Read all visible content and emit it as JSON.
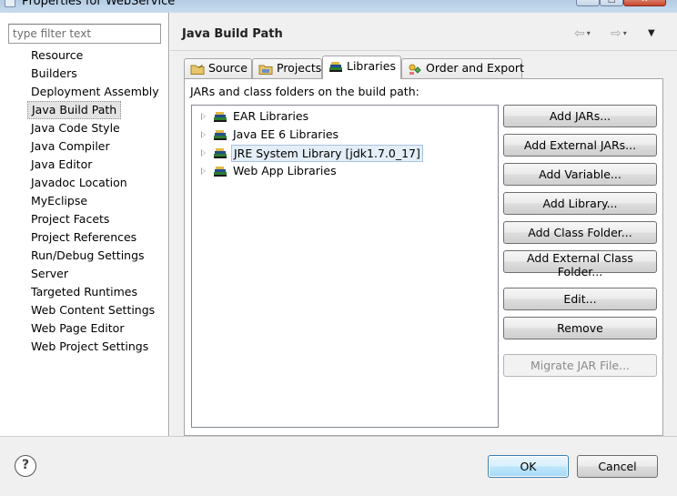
{
  "window": {
    "title": "Properties for WebService",
    "min_glyph": "─",
    "max_glyph": "□",
    "close_glyph": "✕"
  },
  "filter": {
    "placeholder": "type filter text",
    "value": ""
  },
  "nav": {
    "items": [
      {
        "label": "Resource"
      },
      {
        "label": "Builders"
      },
      {
        "label": "Deployment Assembly"
      },
      {
        "label": "Java Build Path",
        "selected": true
      },
      {
        "label": "Java Code Style"
      },
      {
        "label": "Java Compiler"
      },
      {
        "label": "Java Editor"
      },
      {
        "label": "Javadoc Location"
      },
      {
        "label": "MyEclipse"
      },
      {
        "label": "Project Facets"
      },
      {
        "label": "Project References"
      },
      {
        "label": "Run/Debug Settings"
      },
      {
        "label": "Server"
      },
      {
        "label": "Targeted Runtimes"
      },
      {
        "label": "Web Content Settings"
      },
      {
        "label": "Web Page Editor"
      },
      {
        "label": "Web Project Settings"
      }
    ]
  },
  "header": {
    "title": "Java Build Path",
    "back_glyph": "⇦",
    "forward_glyph": "⇨",
    "caret_glyph": "▾",
    "menu_glyph": "▼"
  },
  "tabs": [
    {
      "label": "Source",
      "icon": "source-folder-icon"
    },
    {
      "label": "Projects",
      "icon": "projects-folder-icon"
    },
    {
      "label": "Libraries",
      "icon": "library-books-icon",
      "active": true
    },
    {
      "label": "Order and Export",
      "icon": "order-export-icon"
    }
  ],
  "libraries": {
    "heading": "JARs and class folders on the build path:",
    "tree": [
      {
        "label": "EAR Libraries"
      },
      {
        "label": "Java EE 6 Libraries"
      },
      {
        "label": "JRE System Library [jdk1.7.0_17]",
        "selected": true
      },
      {
        "label": "Web App Libraries"
      }
    ],
    "buttons": {
      "add_jars": "Add JARs...",
      "add_external_jars": "Add External JARs...",
      "add_variable": "Add Variable...",
      "add_library": "Add Library...",
      "add_class_folder": "Add Class Folder...",
      "add_external_class_folder": "Add External Class Folder...",
      "edit": "Edit...",
      "remove": "Remove",
      "migrate_jar": "Migrate JAR File..."
    }
  },
  "footer": {
    "help_glyph": "?",
    "ok": "OK",
    "cancel": "Cancel"
  },
  "colors": {
    "ok_border": "#3c7fb1",
    "selection": "#e4eef8",
    "library_icon_green": "#2e7d32",
    "library_icon_blue": "#1f4e8c"
  }
}
